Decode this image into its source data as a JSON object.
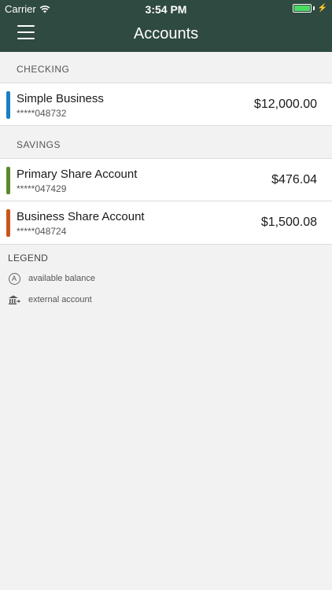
{
  "status_bar": {
    "carrier": "Carrier",
    "time": "3:54 PM"
  },
  "header": {
    "title": "Accounts"
  },
  "sections": {
    "checking": {
      "label": "CHECKING",
      "accounts": [
        {
          "name": "Simple Business",
          "number": "*****048732",
          "balance": "$12,000.00",
          "color": "#1a7fc1"
        }
      ]
    },
    "savings": {
      "label": "SAVINGS",
      "accounts": [
        {
          "name": "Primary Share Account",
          "number": "*****047429",
          "balance": "$476.04",
          "color": "#5a8a2a"
        },
        {
          "name": "Business Share Account",
          "number": "*****048724",
          "balance": "$1,500.08",
          "color": "#c8561a"
        }
      ]
    }
  },
  "legend": {
    "title": "LEGEND",
    "items": [
      {
        "icon": "available-balance-icon",
        "glyph": "A",
        "label": "available balance"
      },
      {
        "icon": "external-account-icon",
        "label": "external account"
      }
    ]
  }
}
